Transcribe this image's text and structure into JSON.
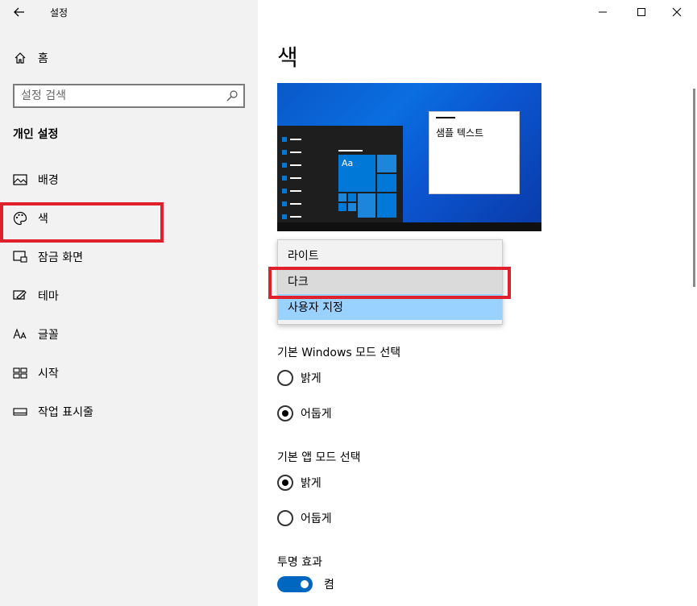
{
  "window": {
    "title": "설정"
  },
  "sidebar": {
    "home_label": "홈",
    "search_placeholder": "설정 검색",
    "section_heading": "개인 설정",
    "items": [
      {
        "label": "배경",
        "icon": "picture-icon"
      },
      {
        "label": "색",
        "icon": "palette-icon",
        "selected": true
      },
      {
        "label": "잠금 화면",
        "icon": "lock-screen-icon"
      },
      {
        "label": "테마",
        "icon": "theme-brush-icon"
      },
      {
        "label": "글꼴",
        "icon": "font-icon"
      },
      {
        "label": "시작",
        "icon": "start-grid-icon"
      },
      {
        "label": "작업 표시줄",
        "icon": "taskbar-icon"
      }
    ]
  },
  "main": {
    "page_title": "색",
    "preview": {
      "sample_text": "샘플 텍스트",
      "tile_label": "Aa"
    },
    "dropdown": {
      "options": [
        "라이트",
        "다크",
        "사용자 지정"
      ],
      "highlighted": "다크",
      "selected": "사용자 지정"
    },
    "windows_mode": {
      "label": "기본 Windows 모드 선택",
      "options": [
        {
          "label": "밝게",
          "checked": false
        },
        {
          "label": "어둡게",
          "checked": true
        }
      ]
    },
    "app_mode": {
      "label": "기본 앱 모드 선택",
      "options": [
        {
          "label": "밝게",
          "checked": true
        },
        {
          "label": "어둡게",
          "checked": false
        }
      ]
    },
    "transparency": {
      "label": "투명 효과",
      "state_label": "켬",
      "on": true
    }
  },
  "colors": {
    "accent": "#0078d7",
    "toggle_on": "#0067c0",
    "annotation": "#e0202a",
    "dropdown_selected": "#99d1ff"
  }
}
